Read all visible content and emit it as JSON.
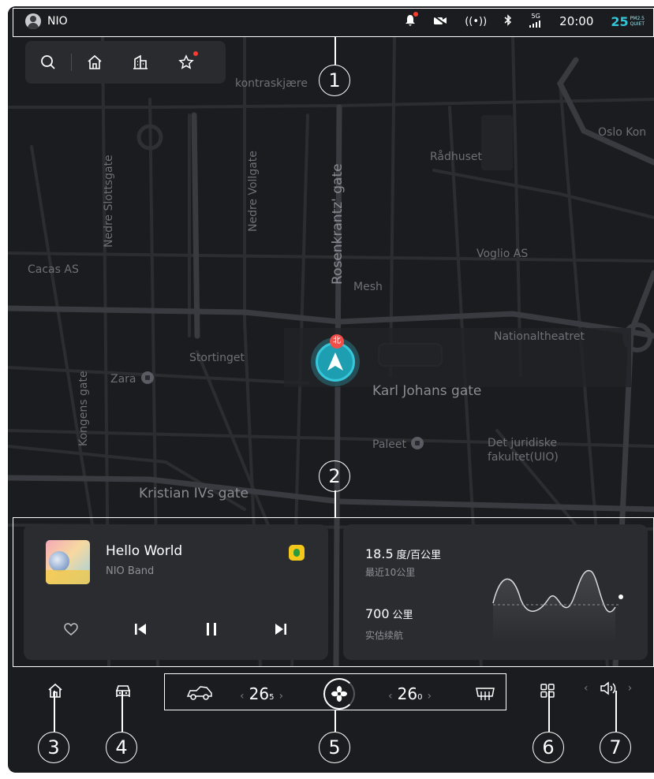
{
  "status_bar": {
    "user_name": "NIO",
    "network": "5G",
    "time": "20:00",
    "air_quality_value": "25",
    "air_quality_unit": "PM2.5",
    "air_quality_label": "QUIET"
  },
  "search_bar": {
    "icons": [
      "search-icon",
      "home-icon",
      "office-icon",
      "star-icon"
    ]
  },
  "map": {
    "labels": {
      "kontraskjaeret": "kontraskjære",
      "oslo_kon": "Oslo Kon",
      "radhuset": "Rådhuset",
      "nedre_slottsgate": "Nedre Slottsgate",
      "nedre_vollgate": "Nedre Vollgate",
      "rosenkrantz": "Rosenkrantz' gate",
      "cacas": "Cacas AS",
      "voglio": "Voglio AS",
      "mesh": "Mesh",
      "nationaltheatret": "Nationaltheatret",
      "stortinget": "Stortinget",
      "zara": "Zara",
      "karl_johans": "Karl Johans gate",
      "kongens": "Kongens gate",
      "paleet": "Paleet",
      "juridiske_1": "Det juridiske",
      "juridiske_2": "fakultet(UIO)",
      "kristian": "Kristian IVs gate"
    },
    "north_label": "北"
  },
  "music_card": {
    "song_title": "Hello World",
    "artist": "NIO Band",
    "state": "playing"
  },
  "energy_card": {
    "consumption_value": "18.5",
    "consumption_unit": "度/百公里",
    "consumption_label": "最近10公里",
    "range_value": "700",
    "range_unit": "公里",
    "range_label": "实估续航"
  },
  "dock": {
    "left_temp_int": "26",
    "left_temp_dec": "5",
    "right_temp_int": "26",
    "right_temp_dec": "0",
    "chev_left": "‹",
    "chev_right": "›"
  },
  "annotations": {
    "n1": "1",
    "n2": "2",
    "n3": "3",
    "n4": "4",
    "n5": "5",
    "n6": "6",
    "n7": "7"
  },
  "colors": {
    "accent": "#33c6d9",
    "background": "#1b1c1f",
    "card": "#2b2c30",
    "alert": "#ff3b30"
  }
}
